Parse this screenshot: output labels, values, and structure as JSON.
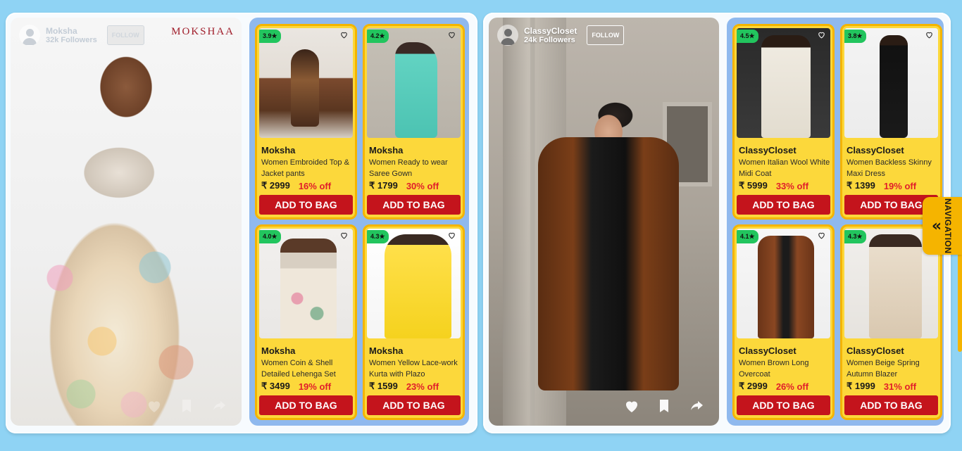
{
  "feed": [
    {
      "creator": {
        "name": "Moksha",
        "followers": "32k Followers",
        "follow_label": "FOLLOW",
        "brand_logo": "MOKSHAA"
      },
      "products": [
        {
          "rating": "3.9★",
          "brand": "Moksha",
          "name": "Women Embroided Top & Jacket pants",
          "price": "₹ 2999",
          "discount": "16% off",
          "cta": "ADD TO BAG"
        },
        {
          "rating": "4.2★",
          "brand": "Moksha",
          "name": "Women Ready to wear Saree Gown",
          "price": "₹ 1799",
          "discount": "30% off",
          "cta": "ADD TO BAG"
        },
        {
          "rating": "4.0★",
          "brand": "Moksha",
          "name": "Women Coin & Shell Detailed Lehenga Set",
          "price": "₹ 3499",
          "discount": "19% off",
          "cta": "ADD TO BAG"
        },
        {
          "rating": "4.3★",
          "brand": "Moksha",
          "name": "Women Yellow Lace-work Kurta with Plazo",
          "price": "₹ 1599",
          "discount": "23% off",
          "cta": "ADD TO BAG"
        }
      ]
    },
    {
      "creator": {
        "name": "ClassyCloset",
        "followers": "24k Followers",
        "follow_label": "FOLLOW"
      },
      "products": [
        {
          "rating": "4.5★",
          "brand": "ClassyCloset",
          "name": "Women Italian Wool White Midi Coat",
          "price": "₹ 5999",
          "discount": "33% off",
          "cta": "ADD TO BAG"
        },
        {
          "rating": "3.8★",
          "brand": "ClassyCloset",
          "name": "Women Backless Skinny Maxi Dress",
          "price": "₹ 1399",
          "discount": "19% off",
          "cta": "ADD TO BAG"
        },
        {
          "rating": "4.1★",
          "brand": "ClassyCloset",
          "name": "Women Brown Long Overcoat",
          "price": "₹ 2999",
          "discount": "26% off",
          "cta": "ADD TO BAG"
        },
        {
          "rating": "4.3★",
          "brand": "ClassyCloset",
          "name": "Women Beige Spring Autumn Blazer",
          "price": "₹ 1999",
          "discount": "31% off",
          "cta": "ADD TO BAG"
        }
      ]
    }
  ],
  "navigation": {
    "label": "NAVIGATION",
    "icon": "double-chevron-left-icon"
  },
  "colors": {
    "card_bg": "#fcd83b",
    "card_border": "#f4b400",
    "cta_bg": "#c4141c",
    "discount": "#e11d2a",
    "rating_bg": "#22c55e",
    "grid_bg": "#8fb9ee",
    "page_bg": "#8fd3f4"
  }
}
